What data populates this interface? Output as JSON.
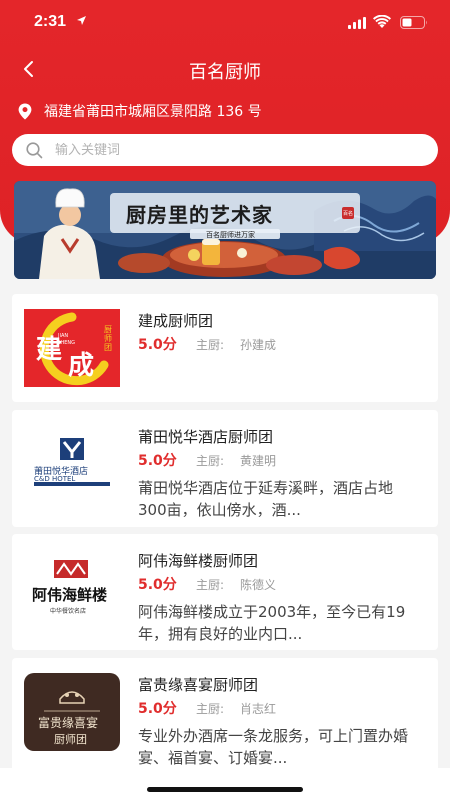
{
  "status": {
    "time": "2:31"
  },
  "header": {
    "title": "百名厨师",
    "location": "福建省莆田市城厢区景阳路 136 号"
  },
  "search": {
    "placeholder": "输入关键词"
  },
  "banner": {
    "title": "厨房里的艺术家",
    "subtitle": "百名厨师进万家",
    "seal": "百名"
  },
  "logo_texts": {
    "jc_big1": "建",
    "jc_big2": "成",
    "jc_side": "厨师团",
    "jc_pin1": "JIAN",
    "jc_pin2": "CHENG",
    "yh_name": "莆田悦华酒店",
    "yh_en": "C&D HOTEL",
    "aw_name": "阿伟海鲜楼",
    "aw_sub": "中华餐饮名店",
    "fg_line1": "富贵缘喜宴",
    "fg_line2": "厨师团"
  },
  "teams": [
    {
      "name": "建成厨师团",
      "score": "5.0分",
      "chef_label": "主厨:",
      "chef": "孙建成",
      "desc": ""
    },
    {
      "name": "莆田悦华酒店厨师团",
      "score": "5.0分",
      "chef_label": "主厨:",
      "chef": "黄建明",
      "desc": "莆田悦华酒店位于延寿溪畔，酒店占地300亩，依山傍水，酒..."
    },
    {
      "name": "阿伟海鲜楼厨师团",
      "score": "5.0分",
      "chef_label": "主厨:",
      "chef": "陈德义",
      "desc": "阿伟海鲜楼成立于2003年，至今已有19年，拥有良好的业内口..."
    },
    {
      "name": "富贵缘喜宴厨师团",
      "score": "5.0分",
      "chef_label": "主厨:",
      "chef": "肖志红",
      "desc": "专业外办酒席一条龙服务，可上门置办婚宴、福首宴、订婚宴..."
    }
  ],
  "colors": {
    "primary": "#e4262a",
    "score": "#e02d2d"
  }
}
